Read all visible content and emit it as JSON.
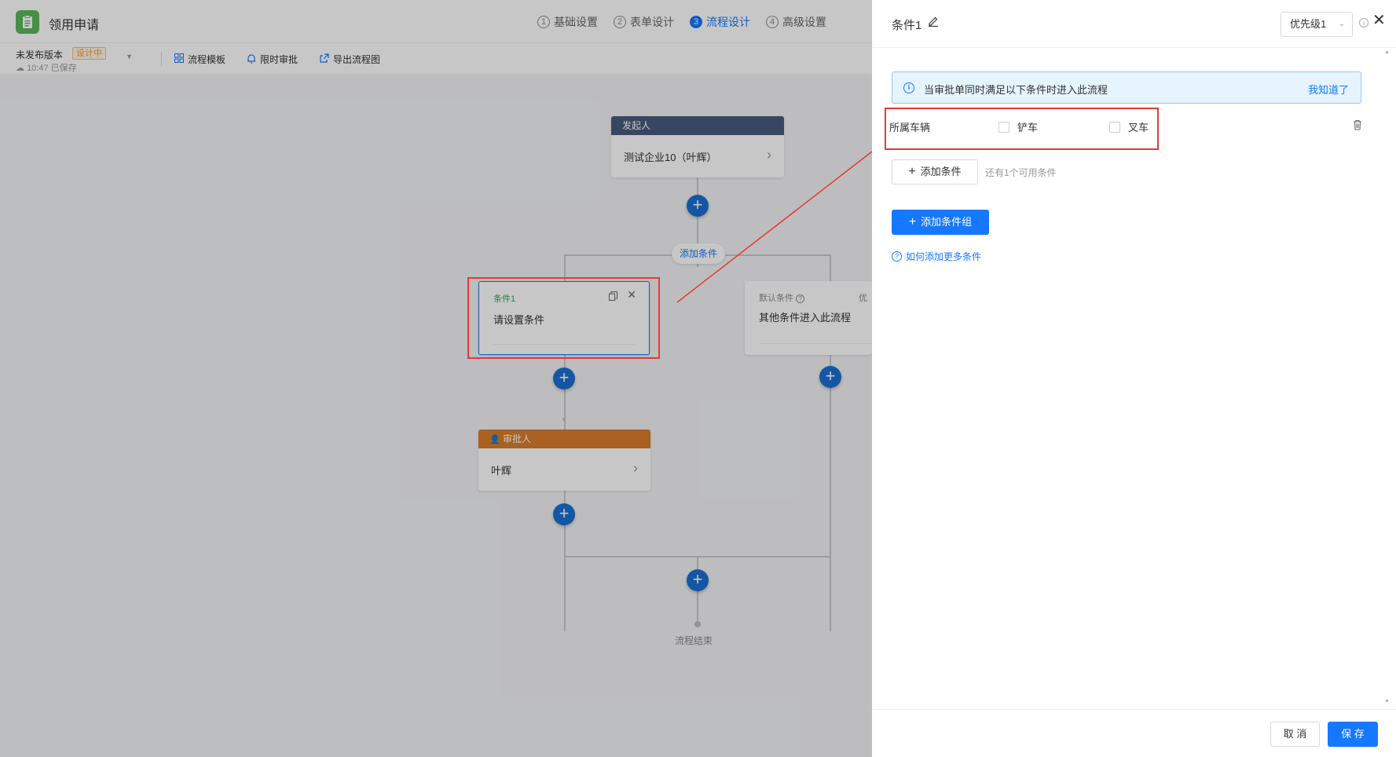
{
  "app": {
    "title": "领用申请",
    "logo_icon": "clipboard-icon",
    "steps": [
      {
        "num": "1",
        "label": "基础设置"
      },
      {
        "num": "2",
        "label": "表单设计"
      },
      {
        "num": "3",
        "label": "流程设计"
      },
      {
        "num": "4",
        "label": "高级设置"
      }
    ],
    "active_step": 2
  },
  "subbar": {
    "version": "未发布版本",
    "badge": "设计中",
    "save_status": "10:47 已保存",
    "tools": [
      {
        "icon": "grid-icon",
        "label": "流程模板"
      },
      {
        "icon": "bell-icon",
        "label": "限时审批"
      },
      {
        "icon": "export-icon",
        "label": "导出流程图"
      }
    ]
  },
  "flow": {
    "initiator": {
      "header": "发起人",
      "text": "测试企业10（叶辉）",
      "color": "#4a5a7d"
    },
    "add_condition_pill": "添加条件",
    "condition1": {
      "title": "条件1",
      "text": "请设置条件",
      "title_color": "#2aa360"
    },
    "default_condition": {
      "title": "默认条件",
      "priority_partial": "优",
      "text": "其他条件进入此流程"
    },
    "approver": {
      "header": "审批人",
      "text": "叶辉",
      "color": "#d97c2b"
    },
    "end_text": "流程结束"
  },
  "drawer": {
    "title": "条件1",
    "priority": "优先级1",
    "notice": "当审批单同时满足以下条件时进入此流程",
    "notice_link": "我知道了",
    "condition": {
      "label": "所属车辆",
      "options": [
        "铲车",
        "叉车"
      ]
    },
    "add_condition_btn": "添加条件",
    "remain_text": "还有1个可用条件",
    "add_group_btn": "添加条件组",
    "help_link": "如何添加更多条件",
    "cancel_btn": "取 消",
    "save_btn": "保 存"
  },
  "colors": {
    "primary": "#1677ff",
    "annotation_red": "#e53935"
  }
}
